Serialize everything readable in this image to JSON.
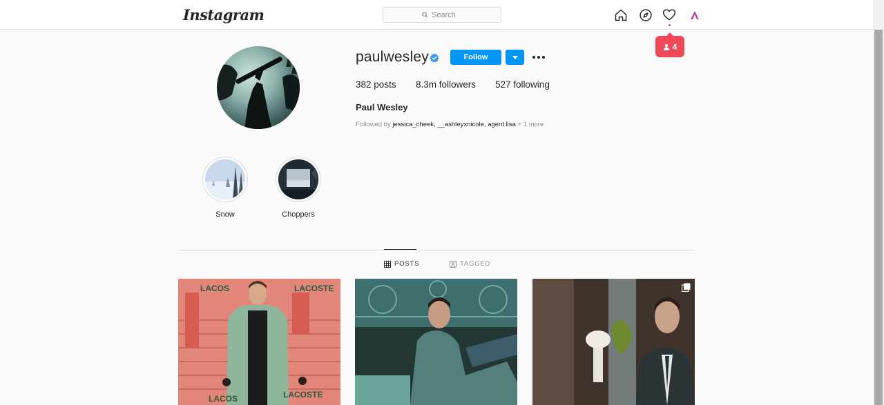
{
  "header": {
    "logo": "Instagram",
    "search_placeholder": "Search",
    "icons": [
      "home-icon",
      "explore-icon",
      "heart-icon",
      "profile-avatar-icon"
    ],
    "notification": {
      "icon": "person-icon",
      "count": "4"
    }
  },
  "profile": {
    "username": "paulwesley",
    "verified": true,
    "follow_label": "Follow",
    "stats": {
      "posts_value": "382",
      "posts_label": "posts",
      "followers_value": "8.3m",
      "followers_label": "followers",
      "following_value": "527",
      "following_label": "following"
    },
    "full_name": "Paul Wesley",
    "followed_by": {
      "prefix": "Followed by",
      "users": [
        "jessica_cheek",
        "__ashleyxnicole",
        "agent.lisa"
      ],
      "sep1": ",",
      "sep2": ",",
      "more": "+ 1 more"
    }
  },
  "highlights": [
    {
      "label": "Snow"
    },
    {
      "label": "Choppers"
    }
  ],
  "tabs": [
    {
      "label": "POSTS",
      "icon": "grid-icon",
      "active": true
    },
    {
      "label": "TAGGED",
      "icon": "tag-icon",
      "active": false
    }
  ],
  "posts": [
    {
      "caption_text_1": "LACOS",
      "caption_text_2": "LACOSTE",
      "multi": false
    },
    {
      "multi": false
    },
    {
      "multi": true
    }
  ],
  "colors": {
    "accent": "#0095f6",
    "notification": "#ed4956",
    "border": "#dbdbdb"
  }
}
